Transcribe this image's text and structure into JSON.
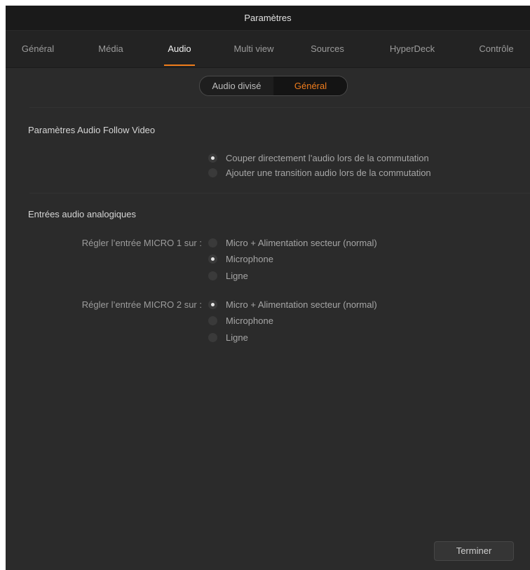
{
  "window": {
    "title": "Paramètres"
  },
  "tabs": [
    {
      "label": "Général"
    },
    {
      "label": "Média"
    },
    {
      "label": "Audio"
    },
    {
      "label": "Multi view"
    },
    {
      "label": "Sources"
    },
    {
      "label": "HyperDeck"
    },
    {
      "label": "Contrôle"
    }
  ],
  "active_tab": "Audio",
  "segmented": {
    "options": [
      "Audio divisé",
      "Général"
    ],
    "selected": "Général"
  },
  "audio_follow_video": {
    "title": "Paramètres Audio Follow Video",
    "options": [
      {
        "label": "Couper directement l’audio lors de la commutation",
        "checked": true
      },
      {
        "label": "Ajouter une transition audio lors de la commutation",
        "checked": false
      }
    ]
  },
  "analog_inputs": {
    "title": "Entrées audio analogiques",
    "mic1": {
      "label": "Régler l’entrée MICRO 1 sur :",
      "options": [
        {
          "label": "Micro + Alimentation secteur (normal)",
          "checked": false
        },
        {
          "label": "Microphone",
          "checked": true
        },
        {
          "label": "Ligne",
          "checked": false
        }
      ]
    },
    "mic2": {
      "label": "Régler l’entrée MICRO 2 sur :",
      "options": [
        {
          "label": "Micro + Alimentation secteur (normal)",
          "checked": true
        },
        {
          "label": "Microphone",
          "checked": false
        },
        {
          "label": "Ligne",
          "checked": false
        }
      ]
    }
  },
  "footer": {
    "done_label": "Terminer"
  },
  "colors": {
    "accent": "#ef7d1c",
    "background": "#2b2b2b",
    "titlebar": "#1a1a1a"
  }
}
